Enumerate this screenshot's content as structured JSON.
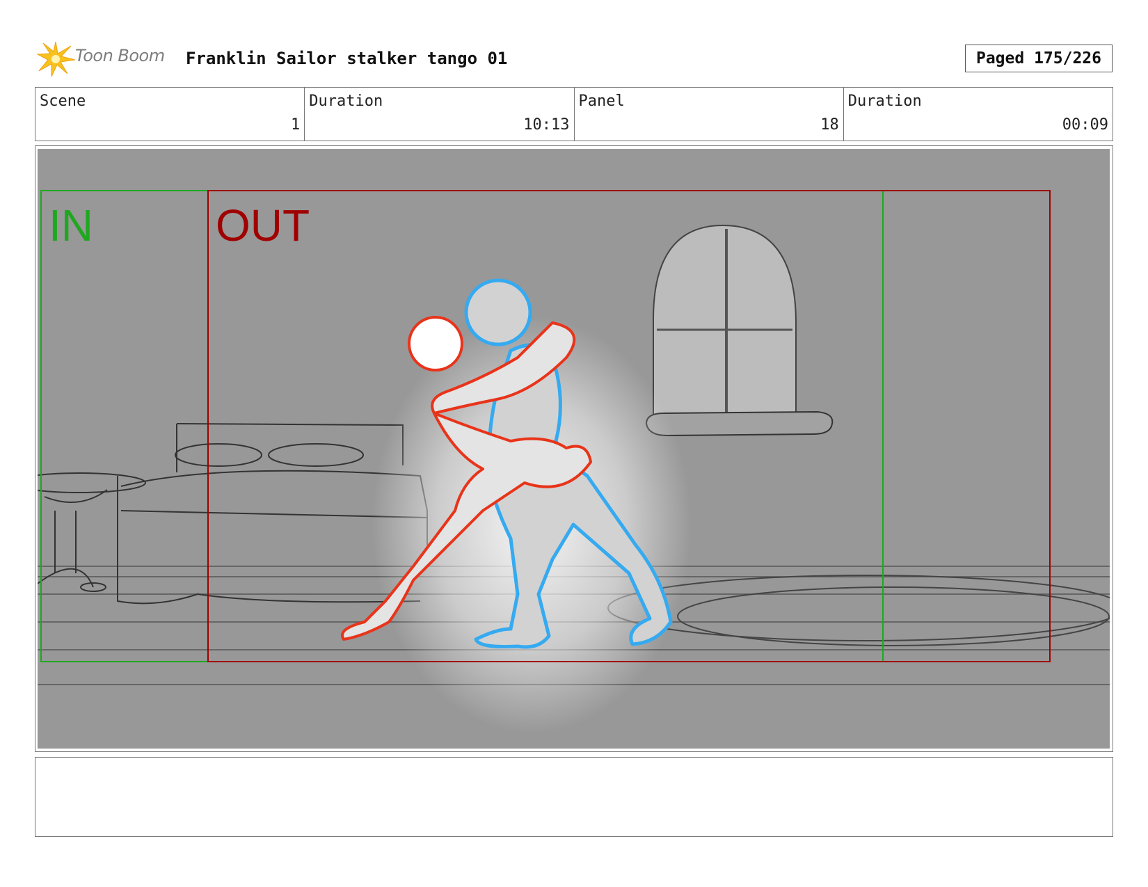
{
  "header": {
    "logo_text": "Toon Boom",
    "title": "Franklin Sailor stalker tango 01",
    "paged": "Paged 175/226"
  },
  "info": {
    "scene_label": "Scene",
    "scene_value": "1",
    "scene_duration_label": "Duration",
    "scene_duration_value": "10:13",
    "panel_label": "Panel",
    "panel_value": "18",
    "panel_duration_label": "Duration",
    "panel_duration_value": "00:09"
  },
  "panel": {
    "in_label": "IN",
    "out_label": "OUT",
    "colors": {
      "in": "#1fa81f",
      "out": "#a00000",
      "figure_a": "#35aaf0",
      "figure_b": "#e8341a",
      "background": "#989898"
    }
  },
  "notes": {
    "text": ""
  }
}
